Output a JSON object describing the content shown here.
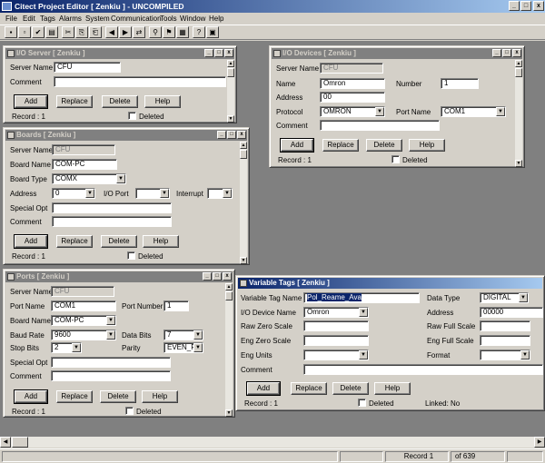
{
  "app": {
    "title": "Citect Project Editor [ Zenkiu ] - UNCOMPILED"
  },
  "window_controls": {
    "minimize": "_",
    "maximize": "□",
    "close": "x"
  },
  "menu": [
    "File",
    "Edit",
    "Tags",
    "Alarms",
    "System",
    "Communication",
    "Tools",
    "Window",
    "Help"
  ],
  "toolbar_icons": [
    "new-icon",
    "open-icon",
    "compile-icon",
    "print-icon",
    "cut-icon",
    "copy-icon",
    "paste-icon",
    "prev-record-icon",
    "next-record-icon",
    "link-icon",
    "find-icon",
    "run-icon",
    "tag-icon",
    "help-icon",
    "book-icon"
  ],
  "toolbar_glyphs": [
    "▪",
    "▫",
    "✔",
    "▤",
    "✂",
    "⎘",
    "⎗",
    "◀",
    "▶",
    "⇄",
    "⚲",
    "⚑",
    "▦",
    "?",
    "▣"
  ],
  "mdi_controls": {
    "minimize": "_",
    "restore": "□",
    "close": "x"
  },
  "io_server": {
    "title": "I/O Server [ Zenkiu ]",
    "server_name_label": "Server Name",
    "server_name": "CFU",
    "comment_label": "Comment",
    "comment": "",
    "add": "Add",
    "replace": "Replace",
    "delete": "Delete",
    "help": "Help",
    "record": "Record :  1",
    "deleted": "Deleted"
  },
  "io_devices": {
    "title": "I/O Devices [ Zenkiu ]",
    "server_name_label": "Server Name",
    "server_name": "CFU",
    "name_label": "Name",
    "name": "Omron",
    "number_label": "Number",
    "number": "1",
    "address_label": "Address",
    "address": "00",
    "protocol_label": "Protocol",
    "protocol": "OMRON",
    "port_name_label": "Port Name",
    "port_name": "COM1",
    "comment_label": "Comment",
    "comment": "",
    "add": "Add",
    "replace": "Replace",
    "delete": "Delete",
    "help": "Help",
    "record": "Record :  1",
    "deleted": "Deleted"
  },
  "boards": {
    "title": "Boards [ Zenkiu ]",
    "server_name_label": "Server Name",
    "server_name": "CFU",
    "board_name_label": "Board Name",
    "board_name": "COM-PC",
    "board_type_label": "Board Type",
    "board_type": "COMX",
    "address_label": "Address",
    "address": "0",
    "io_port_label": "I/O Port",
    "io_port": "",
    "interrupt_label": "Interrupt",
    "interrupt": "",
    "special_opt_label": "Special Opt",
    "special_opt": "",
    "comment_label": "Comment",
    "comment": "",
    "add": "Add",
    "replace": "Replace",
    "delete": "Delete",
    "help": "Help",
    "record": "Record :  1",
    "deleted": "Deleted"
  },
  "ports": {
    "title": "Ports [ Zenkiu ]",
    "server_name_label": "Server Name",
    "server_name": "CFU",
    "port_name_label": "Port Name",
    "port_name": "COM1",
    "port_number_label": "Port Number",
    "port_number": "1",
    "board_name_label": "Board Name",
    "board_name": "COM-PC",
    "baud_rate_label": "Baud Rate",
    "baud_rate": "9600",
    "data_bits_label": "Data Bits",
    "data_bits": "7",
    "stop_bits_label": "Stop Bits",
    "stop_bits": "2",
    "parity_label": "Parity",
    "parity": "EVEN_P",
    "special_opt_label": "Special Opt",
    "special_opt": "",
    "comment_label": "Comment",
    "comment": "",
    "add": "Add",
    "replace": "Replace",
    "delete": "Delete",
    "help": "Help",
    "record": "Record :  1",
    "deleted": "Deleted"
  },
  "variable_tags": {
    "title": "Variable Tags [ Zenkiu ]",
    "tag_name_label": "Variable Tag Name",
    "tag_name": "Pol_Reame_Ava",
    "data_type_label": "Data Type",
    "data_type": "DIGITAL",
    "io_device_label": "I/O Device Name",
    "io_device": "Omron",
    "address_label": "Address",
    "address": "00000",
    "raw_zero_label": "Raw Zero Scale",
    "raw_zero": "",
    "raw_full_label": "Raw Full Scale",
    "raw_full": "",
    "eng_zero_label": "Eng Zero Scale",
    "eng_zero": "",
    "eng_full_label": "Eng Full Scale",
    "eng_full": "",
    "eng_units_label": "Eng Units",
    "eng_units": "",
    "format_label": "Format",
    "format": "",
    "comment_label": "Comment",
    "comment": "",
    "add": "Add",
    "replace": "Replace",
    "delete": "Delete",
    "help": "Help",
    "record": "Record :  1",
    "deleted": "Deleted",
    "linked": "Linked: No"
  },
  "status": {
    "record": "Record 1",
    "of": "of 639"
  }
}
